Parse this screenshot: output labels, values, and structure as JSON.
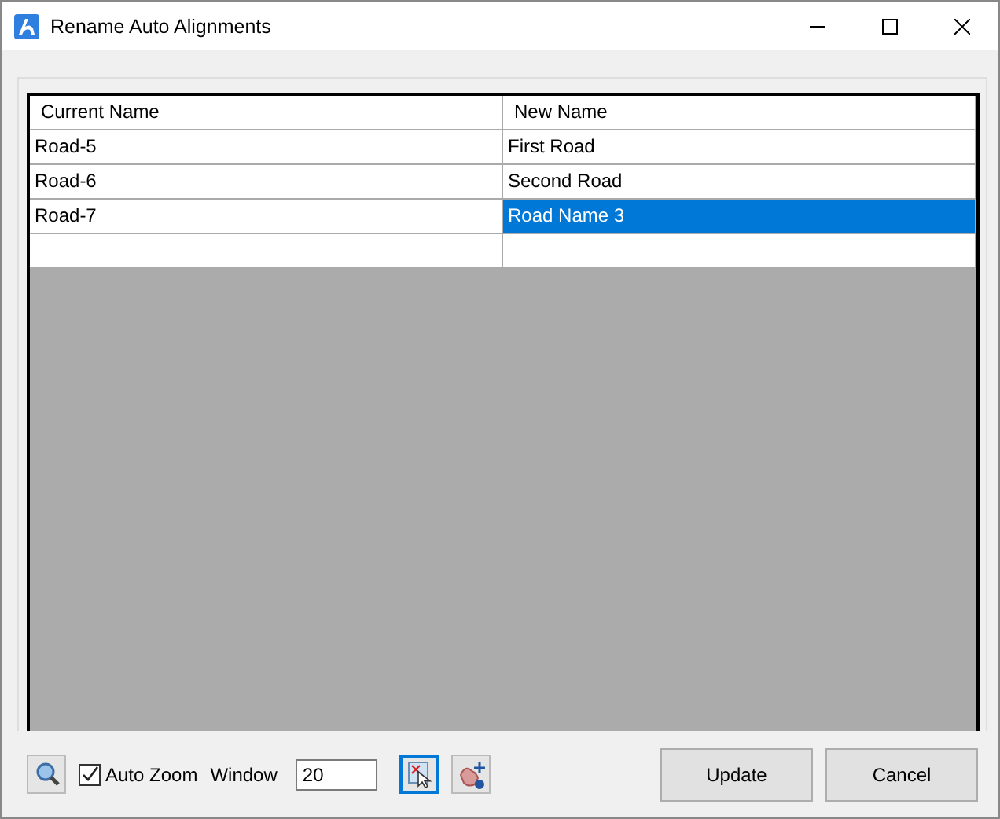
{
  "window": {
    "title": "Rename Auto Alignments"
  },
  "table": {
    "columns": [
      "Current Name",
      "New Name"
    ],
    "rows": [
      {
        "current": "Road-5",
        "new": "First Road",
        "selected": false
      },
      {
        "current": "Road-6",
        "new": "Second Road",
        "selected": false
      },
      {
        "current": "Road-7",
        "new": "Road Name 3",
        "selected": true
      }
    ]
  },
  "auto_zoom": {
    "label": "Auto Zoom",
    "checked": true
  },
  "window_field": {
    "label": "Window",
    "value": "20"
  },
  "buttons": [
    "Update",
    "Cancel"
  ]
}
